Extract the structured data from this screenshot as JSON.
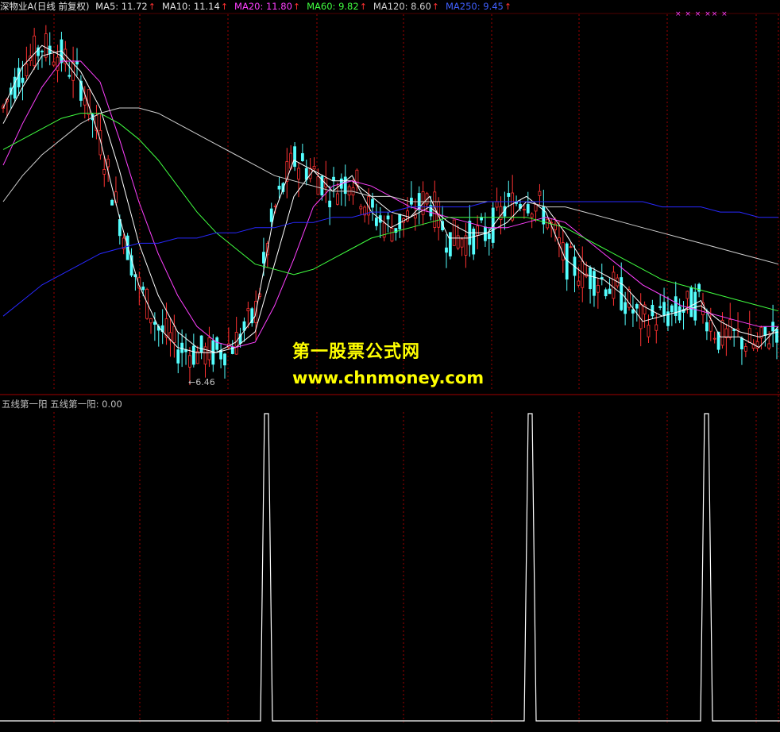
{
  "header": {
    "stock": "深物业A(日线 前复权)",
    "ma": [
      {
        "label": "MA5: 11.72",
        "color": "#e0e0e0"
      },
      {
        "label": "MA10: 11.14",
        "color": "#e0e0e0"
      },
      {
        "label": "MA20: 11.80",
        "color": "#ff40ff"
      },
      {
        "label": "MA60: 9.82",
        "color": "#40ff40"
      },
      {
        "label": "MA120: 8.60",
        "color": "#d0d0d0"
      },
      {
        "label": "MA250: 9.45",
        "color": "#4060ff"
      }
    ],
    "arrow": "↑"
  },
  "low_label": "←6.46",
  "marks": "× ×   ×   ××   ×",
  "lower": {
    "header": "五线第一阳  五线第一阳: 0.00"
  },
  "watermark": {
    "line1": "第一股票公式网",
    "line2": "www.chnmoney.com"
  },
  "colors": {
    "up": "#ff3232",
    "down": "#54ffff",
    "divider": "#a00000",
    "grid": "#a00000"
  },
  "chart_data": {
    "type": "line",
    "ma_lines": [
      {
        "name": "MA5",
        "color": "#ffffff",
        "values": [
          11.6,
          12.4,
          12.8,
          12.6,
          12.1,
          11.0,
          9.5,
          8.2,
          7.4,
          7.0,
          6.9,
          6.9,
          7.1,
          7.6,
          9.6,
          10.6,
          10.4,
          10.0,
          10.3,
          9.6,
          9.3,
          9.5,
          9.9,
          9.1,
          9.1,
          9.2,
          9.7,
          9.9,
          9.6,
          8.7,
          8.4,
          8.3,
          8.0,
          7.5,
          7.6,
          7.7,
          7.9,
          7.2,
          7.2,
          7.0,
          7.4
        ]
      },
      {
        "name": "MA10",
        "color": "#ffffff",
        "values": [
          11.3,
          12.0,
          12.6,
          12.7,
          12.3,
          11.6,
          10.4,
          9.0,
          8.0,
          7.3,
          7.0,
          6.9,
          7.0,
          7.3,
          8.6,
          9.9,
          10.4,
          10.2,
          10.2,
          9.9,
          9.6,
          9.5,
          9.7,
          9.4,
          9.2,
          9.2,
          9.4,
          9.8,
          9.7,
          9.2,
          8.6,
          8.4,
          8.2,
          7.8,
          7.6,
          7.7,
          7.8,
          7.5,
          7.3,
          7.2,
          7.3
        ]
      },
      {
        "name": "MA20",
        "color": "#ff40ff",
        "values": [
          10.5,
          11.3,
          12.0,
          12.5,
          12.5,
          12.1,
          11.0,
          9.8,
          8.8,
          8.0,
          7.4,
          7.1,
          7.0,
          7.1,
          7.8,
          8.7,
          9.7,
          10.1,
          10.2,
          10.1,
          9.9,
          9.7,
          9.6,
          9.5,
          9.4,
          9.3,
          9.3,
          9.4,
          9.5,
          9.4,
          9.1,
          8.8,
          8.5,
          8.2,
          8.0,
          7.8,
          7.7,
          7.6,
          7.5,
          7.4,
          7.4
        ]
      },
      {
        "name": "MA60",
        "color": "#40ff40",
        "values": [
          10.8,
          11.0,
          11.2,
          11.4,
          11.5,
          11.5,
          11.3,
          11.0,
          10.6,
          10.1,
          9.6,
          9.2,
          8.9,
          8.6,
          8.5,
          8.4,
          8.5,
          8.7,
          8.9,
          9.1,
          9.2,
          9.3,
          9.4,
          9.5,
          9.5,
          9.5,
          9.5,
          9.5,
          9.4,
          9.3,
          9.1,
          8.9,
          8.7,
          8.5,
          8.3,
          8.2,
          8.1,
          8.0,
          7.9,
          7.8,
          7.7
        ]
      },
      {
        "name": "MA120",
        "color": "#d0d0d0",
        "values": [
          9.8,
          10.3,
          10.7,
          11.0,
          11.3,
          11.5,
          11.6,
          11.6,
          11.5,
          11.3,
          11.1,
          10.9,
          10.7,
          10.5,
          10.3,
          10.2,
          10.1,
          10.0,
          10.0,
          9.9,
          9.9,
          9.8,
          9.8,
          9.8,
          9.8,
          9.8,
          9.8,
          9.8,
          9.7,
          9.7,
          9.6,
          9.5,
          9.4,
          9.3,
          9.2,
          9.1,
          9.0,
          8.9,
          8.8,
          8.7,
          8.6
        ]
      },
      {
        "name": "MA250",
        "color": "#2828ff",
        "values": [
          7.6,
          7.9,
          8.2,
          8.4,
          8.6,
          8.8,
          8.9,
          9.0,
          9.0,
          9.1,
          9.1,
          9.2,
          9.2,
          9.3,
          9.3,
          9.4,
          9.4,
          9.5,
          9.5,
          9.6,
          9.6,
          9.7,
          9.7,
          9.7,
          9.7,
          9.8,
          9.8,
          9.8,
          9.8,
          9.8,
          9.8,
          9.8,
          9.8,
          9.8,
          9.7,
          9.7,
          9.7,
          9.6,
          9.6,
          9.5,
          9.5
        ]
      }
    ],
    "signal_peaks": [
      336,
      668,
      890
    ],
    "signal_value": 0.0
  }
}
